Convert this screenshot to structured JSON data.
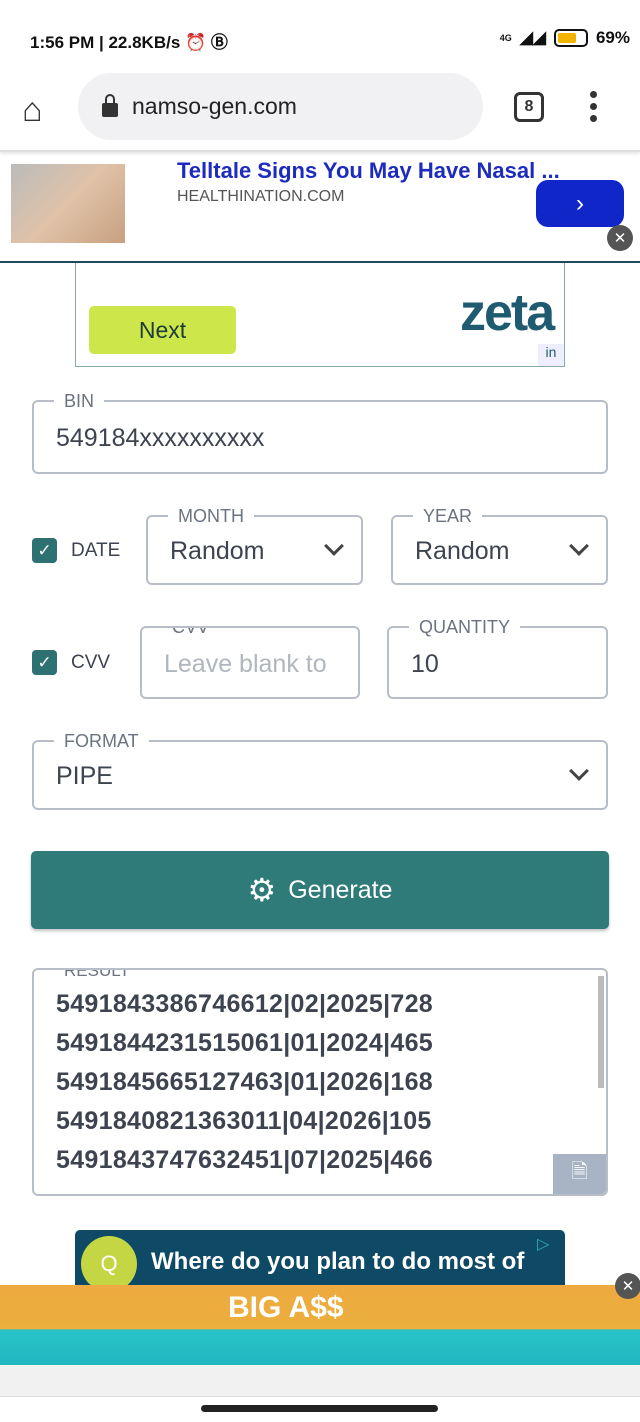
{
  "status_bar": {
    "time": "1:56 PM",
    "speed": "22.8KB/s",
    "network": "4G",
    "battery": "69%"
  },
  "browser": {
    "url": "namso-gen.com",
    "tab_count": "8"
  },
  "ad_top": {
    "title": "Telltale Signs You May Have Nasal ...",
    "source": "HEALTHINATION.COM",
    "arrow": "›",
    "close": "✕"
  },
  "ad_zeta": {
    "button": "Next",
    "logo": "zeta",
    "badge": "in"
  },
  "form": {
    "bin": {
      "label": "BIN",
      "value": "549184xxxxxxxxxx"
    },
    "date": {
      "label": "DATE",
      "checked": true
    },
    "month": {
      "label": "MONTH",
      "value": "Random"
    },
    "year": {
      "label": "YEAR",
      "value": "Random"
    },
    "cvv_check": {
      "label": "CVV",
      "checked": true
    },
    "cvv": {
      "label": "CVV",
      "placeholder": "Leave blank to"
    },
    "quantity": {
      "label": "QUANTITY",
      "value": "10"
    },
    "format": {
      "label": "FORMAT",
      "value": "PIPE"
    },
    "generate": "Generate",
    "result": {
      "label": "RESULT",
      "lines": [
        "5491843386746612|02|2025|728",
        "5491844231515061|01|2024|465",
        "5491845665127463|01|2026|168",
        "5491840821363011|04|2026|105",
        "5491843747632451|07|2025|466"
      ]
    }
  },
  "ad_bottom": {
    "question_badge": "Q",
    "question": "Where do you plan to do most of",
    "banner": "BIG A$$",
    "close": "✕"
  },
  "colors": {
    "accent": "#2e7b7a",
    "ad_blue": "#1126c8",
    "ad_title": "#1d2bbf"
  }
}
